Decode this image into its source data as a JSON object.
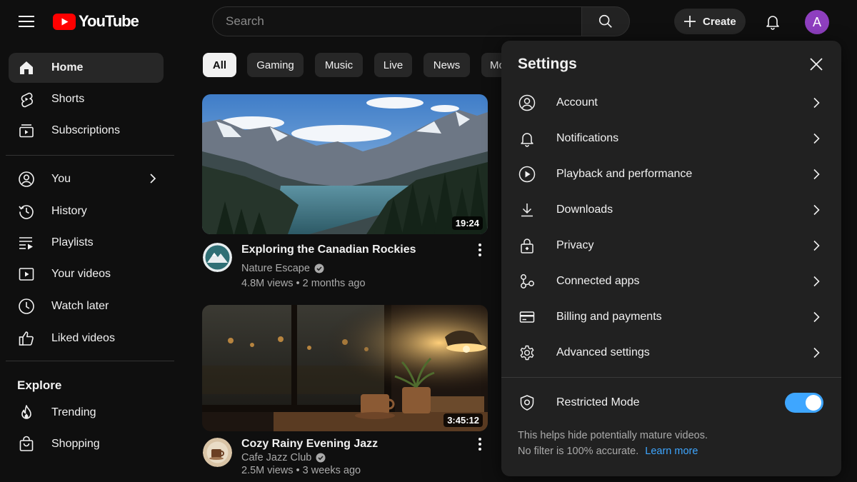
{
  "topbar": {
    "logo_text": "YouTube",
    "search_placeholder": "Search",
    "create_label": "Create",
    "avatar_letter": "A"
  },
  "sidebar": {
    "main": [
      {
        "label": "Home",
        "icon": "home-icon"
      },
      {
        "label": "Shorts",
        "icon": "shorts-icon"
      },
      {
        "label": "Subscriptions",
        "icon": "subscriptions-icon"
      }
    ],
    "you": [
      {
        "label": "You",
        "icon": "person-icon"
      },
      {
        "label": "History",
        "icon": "history-icon"
      },
      {
        "label": "Playlists",
        "icon": "playlists-icon"
      },
      {
        "label": "Your videos",
        "icon": "your-videos-icon"
      },
      {
        "label": "Watch later",
        "icon": "clock-icon"
      },
      {
        "label": "Liked videos",
        "icon": "thumbs-up-icon"
      }
    ],
    "explore_heading": "Explore",
    "explore": [
      {
        "label": "Trending",
        "icon": "flame-icon"
      },
      {
        "label": "Shopping",
        "icon": "shopping-bag-icon"
      }
    ]
  },
  "chips": [
    "All",
    "Gaming",
    "Music",
    "Live",
    "News",
    "Mo"
  ],
  "videos": [
    {
      "title": "Exploring the Canadian Rockies",
      "channel": "Nature Escape",
      "meta": "4.8M views • 2 months ago",
      "duration": "19:24"
    },
    {
      "title": "Cozy Rainy Evening Jazz",
      "channel": "Cafe Jazz Club",
      "meta": "2.5M views • 3 weeks ago",
      "duration": "3:45:12"
    }
  ],
  "settings": {
    "title": "Settings",
    "items": [
      {
        "label": "Account",
        "icon": "account-icon"
      },
      {
        "label": "Notifications",
        "icon": "bell-icon"
      },
      {
        "label": "Playback and performance",
        "icon": "play-circle-icon"
      },
      {
        "label": "Downloads",
        "icon": "download-icon"
      },
      {
        "label": "Privacy",
        "icon": "lock-icon"
      },
      {
        "label": "Connected apps",
        "icon": "connected-apps-icon"
      },
      {
        "label": "Billing and payments",
        "icon": "credit-card-icon"
      },
      {
        "label": "Advanced settings",
        "icon": "gear-icon"
      }
    ],
    "restricted_label": "Restricted Mode",
    "restricted_on": true,
    "help_line1": "This helps hide potentially mature videos.",
    "help_line2": "No filter is 100% accurate.",
    "learn_more": "Learn more"
  },
  "colors": {
    "background": "#0f0f0f",
    "panel": "#212121",
    "brand_red": "#ff0000",
    "accent_blue": "#3ea6ff",
    "avatar": "#8e3fbf"
  }
}
